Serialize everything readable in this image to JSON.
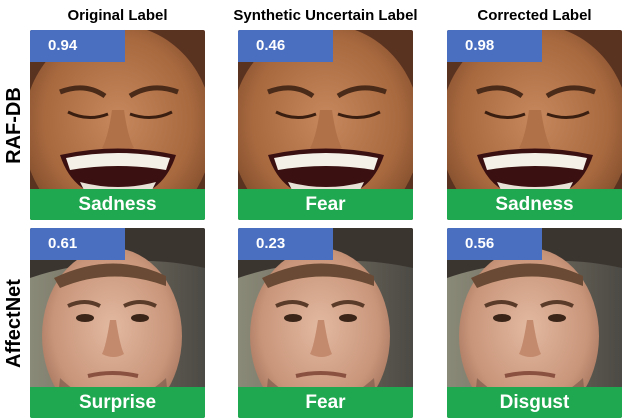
{
  "columns": [
    {
      "title": "Original Label"
    },
    {
      "title": "Synthetic Uncertain Label"
    },
    {
      "title": "Corrected Label"
    }
  ],
  "rows": [
    {
      "dataset": "RAF-DB",
      "cells": [
        {
          "score": "0.94",
          "label": "Sadness"
        },
        {
          "score": "0.46",
          "label": "Fear"
        },
        {
          "score": "0.98",
          "label": "Sadness"
        }
      ]
    },
    {
      "dataset": "AffectNet",
      "cells": [
        {
          "score": "0.61",
          "label": "Surprise"
        },
        {
          "score": "0.23",
          "label": "Fear"
        },
        {
          "score": "0.56",
          "label": "Disgust"
        }
      ]
    }
  ],
  "colors": {
    "score_bg": "#4a6fc0",
    "label_bg": "#1fa84f"
  }
}
